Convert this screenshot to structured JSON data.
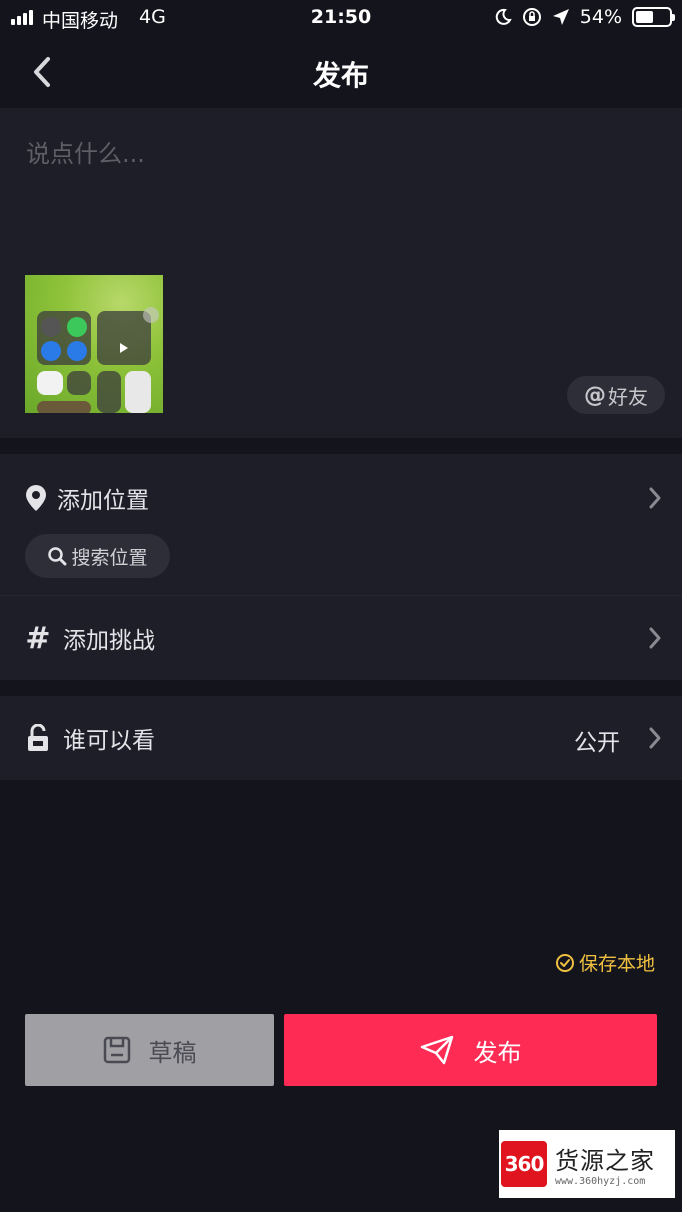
{
  "status_bar": {
    "carrier": "中国移动",
    "network": "4G",
    "time": "21:50",
    "battery": "54%",
    "battery_level": 0.54,
    "icons": [
      "signal-icon",
      "moon-icon",
      "rotation-lock-icon",
      "location-arrow-icon",
      "battery-icon"
    ]
  },
  "nav": {
    "title": "发布",
    "back_icon": "chevron-left-icon"
  },
  "caption": {
    "placeholder": "说点什么...",
    "value": "",
    "mention_label": "好友",
    "mention_symbol": "@"
  },
  "location": {
    "label": "添加位置",
    "search_label": "搜索位置",
    "icon": "location-pin-icon"
  },
  "challenge": {
    "label": "添加挑战",
    "icon": "hashtag-icon"
  },
  "privacy": {
    "label": "谁可以看",
    "value": "公开",
    "icon": "unlock-icon"
  },
  "save_local": {
    "label": "保存本地",
    "checked": true,
    "color": "#f0c040"
  },
  "buttons": {
    "draft_label": "草稿",
    "publish_label": "发布"
  },
  "watermark": {
    "logo": "360",
    "name": "货源之家",
    "url": "www.360hyzj.com"
  },
  "colors": {
    "background": "#14141d",
    "panel": "#1e1e28",
    "accent": "#fe2c55",
    "draft": "#a0a0a4"
  }
}
